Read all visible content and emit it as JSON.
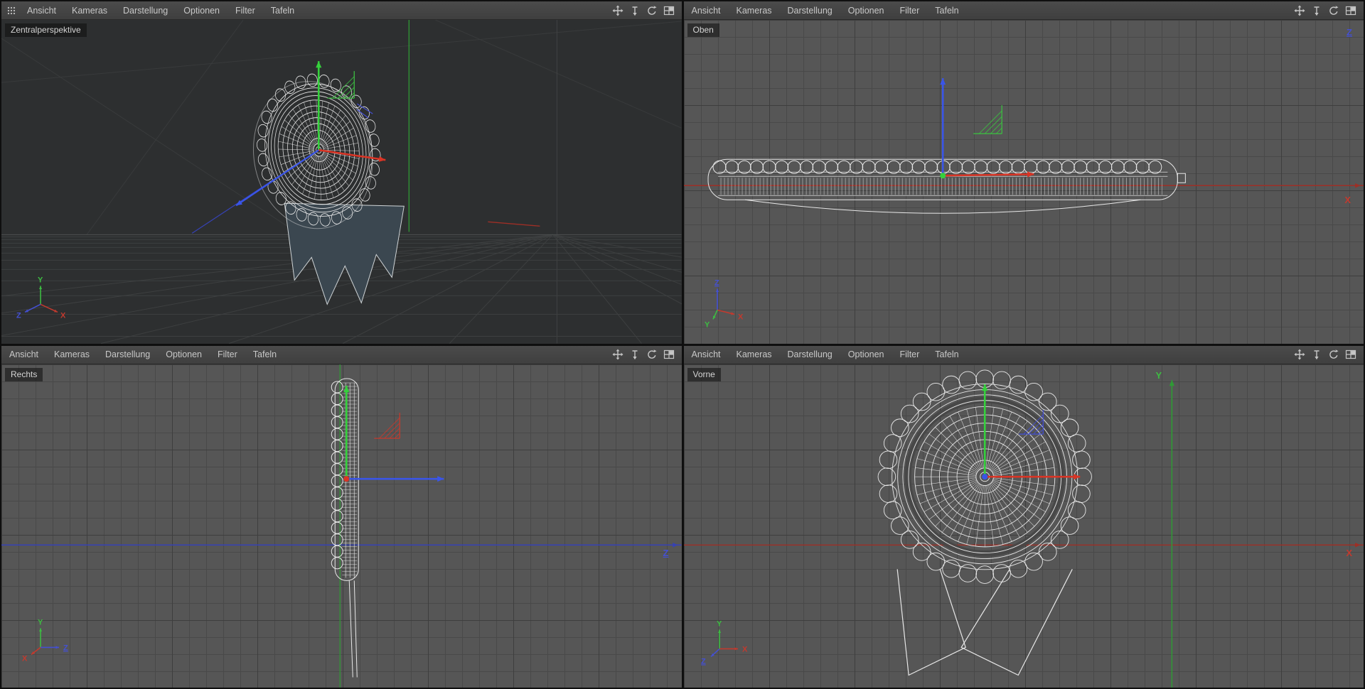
{
  "menu": {
    "items": [
      "Ansicht",
      "Kameras",
      "Darstellung",
      "Optionen",
      "Filter",
      "Tafeln"
    ]
  },
  "view_tools": [
    "move-view-icon",
    "zoom-view-icon",
    "rotate-view-icon",
    "toggle-layout-icon"
  ],
  "viewports": [
    {
      "label": "Zentralperspektive"
    },
    {
      "label": "Oben"
    },
    {
      "label": "Rechts"
    },
    {
      "label": "Vorne"
    }
  ],
  "axis_labels": {
    "x": "X",
    "y": "Y",
    "z": "Z"
  },
  "colors": {
    "x_axis": "#c23a2e",
    "y_axis": "#3dbb42",
    "z_axis": "#4450d2",
    "x_bright": "#d93425",
    "y_bright": "#35d13c",
    "z_bright": "#3a55e8",
    "x_line": "#9e2f26",
    "y_line": "#2f9a35",
    "z_line": "#3642b4",
    "wire": "#e8e8e8",
    "ribbon": "#3b4750",
    "bg_perspective": "#2d2f30",
    "bg_ortho": "#565656",
    "menubar": "#454545"
  }
}
